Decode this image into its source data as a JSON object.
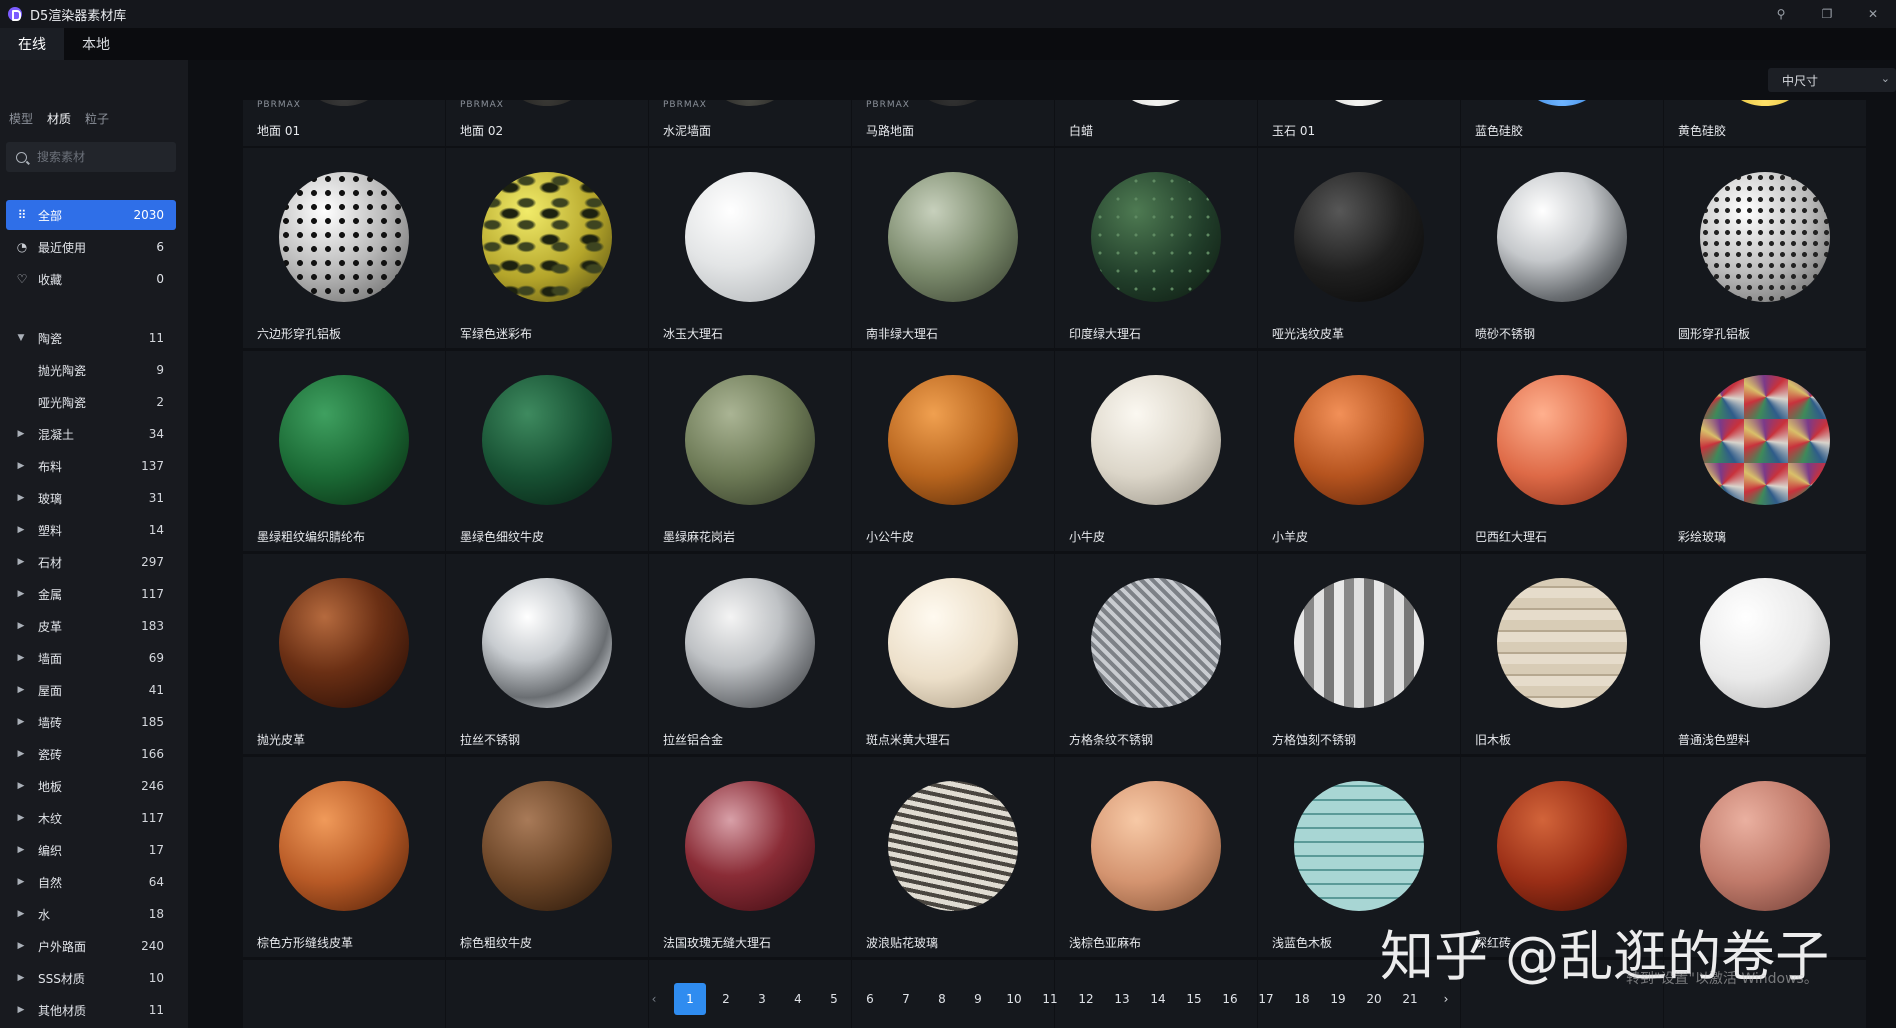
{
  "window": {
    "title": "D5渲染器素材库"
  },
  "topnav": {
    "tabs": [
      {
        "label": "在线"
      },
      {
        "label": "本地"
      }
    ]
  },
  "toolbar": {
    "size_select": "中尺寸"
  },
  "sidebar": {
    "type_tabs": [
      {
        "label": "模型"
      },
      {
        "label": "材质"
      },
      {
        "label": "粒子"
      }
    ],
    "search_placeholder": "搜索素材",
    "quick": [
      {
        "label": "全部",
        "count": "2030"
      },
      {
        "label": "最近使用",
        "count": "6"
      },
      {
        "label": "收藏",
        "count": "0"
      }
    ],
    "tree": [
      {
        "label": "陶瓷",
        "count": "11"
      },
      {
        "label": "抛光陶瓷",
        "count": "9"
      },
      {
        "label": "哑光陶瓷",
        "count": "2"
      },
      {
        "label": "混凝土",
        "count": "34"
      },
      {
        "label": "布料",
        "count": "137"
      },
      {
        "label": "玻璃",
        "count": "31"
      },
      {
        "label": "塑料",
        "count": "14"
      },
      {
        "label": "石材",
        "count": "297"
      },
      {
        "label": "金属",
        "count": "117"
      },
      {
        "label": "皮革",
        "count": "183"
      },
      {
        "label": "墙面",
        "count": "69"
      },
      {
        "label": "屋面",
        "count": "41"
      },
      {
        "label": "墙砖",
        "count": "185"
      },
      {
        "label": "瓷砖",
        "count": "166"
      },
      {
        "label": "地板",
        "count": "246"
      },
      {
        "label": "木纹",
        "count": "117"
      },
      {
        "label": "编织",
        "count": "17"
      },
      {
        "label": "自然",
        "count": "64"
      },
      {
        "label": "水",
        "count": "18"
      },
      {
        "label": "户外路面",
        "count": "240"
      },
      {
        "label": "SSS材质",
        "count": "10"
      },
      {
        "label": "其他材质",
        "count": "11"
      }
    ]
  },
  "grid": {
    "brand_tag": "PBRMAX",
    "top_row": [
      {
        "name": "地面 01"
      },
      {
        "name": "地面 02"
      },
      {
        "name": "水泥墙面"
      },
      {
        "name": "马路地面"
      },
      {
        "name": "白蜡"
      },
      {
        "name": "玉石 01"
      },
      {
        "name": "蓝色硅胶"
      },
      {
        "name": "黄色硅胶"
      }
    ],
    "rows": [
      [
        {
          "name": "六边形穿孔铝板"
        },
        {
          "name": "军绿色迷彩布"
        },
        {
          "name": "冰玉大理石"
        },
        {
          "name": "南非绿大理石"
        },
        {
          "name": "印度绿大理石"
        },
        {
          "name": "哑光浅纹皮革"
        },
        {
          "name": "喷砂不锈钢"
        },
        {
          "name": "圆形穿孔铝板"
        }
      ],
      [
        {
          "name": "墨绿粗纹编织腈纶布"
        },
        {
          "name": "墨绿色细纹牛皮"
        },
        {
          "name": "墨绿麻花岗岩"
        },
        {
          "name": "小公牛皮"
        },
        {
          "name": "小牛皮"
        },
        {
          "name": "小羊皮"
        },
        {
          "name": "巴西红大理石"
        },
        {
          "name": "彩绘玻璃"
        }
      ],
      [
        {
          "name": "抛光皮革"
        },
        {
          "name": "拉丝不锈钢"
        },
        {
          "name": "拉丝铝合金"
        },
        {
          "name": "斑点米黄大理石"
        },
        {
          "name": "方格条纹不锈钢"
        },
        {
          "name": "方格蚀刻不锈钢"
        },
        {
          "name": "旧木板"
        },
        {
          "name": "普通浅色塑料"
        }
      ],
      [
        {
          "name": "棕色方形缝线皮革"
        },
        {
          "name": "棕色粗纹牛皮"
        },
        {
          "name": "法国玫瑰无缝大理石"
        },
        {
          "name": "波浪贴花玻璃"
        },
        {
          "name": "浅棕色亚麻布"
        },
        {
          "name": "浅蓝色木板"
        },
        {
          "name": "深红砖"
        },
        {
          "name": ""
        }
      ]
    ]
  },
  "pagination": {
    "prev": "‹",
    "next": "›",
    "pages": [
      "1",
      "2",
      "3",
      "4",
      "5",
      "6",
      "7",
      "8",
      "9",
      "10",
      "11",
      "12",
      "13",
      "14",
      "15",
      "16",
      "17",
      "18",
      "19",
      "20",
      "21"
    ],
    "current": "1"
  },
  "watermark": {
    "text": "知乎 @乱逛的卷子",
    "activation": "转到\"设置\"以激活 Windows。"
  }
}
